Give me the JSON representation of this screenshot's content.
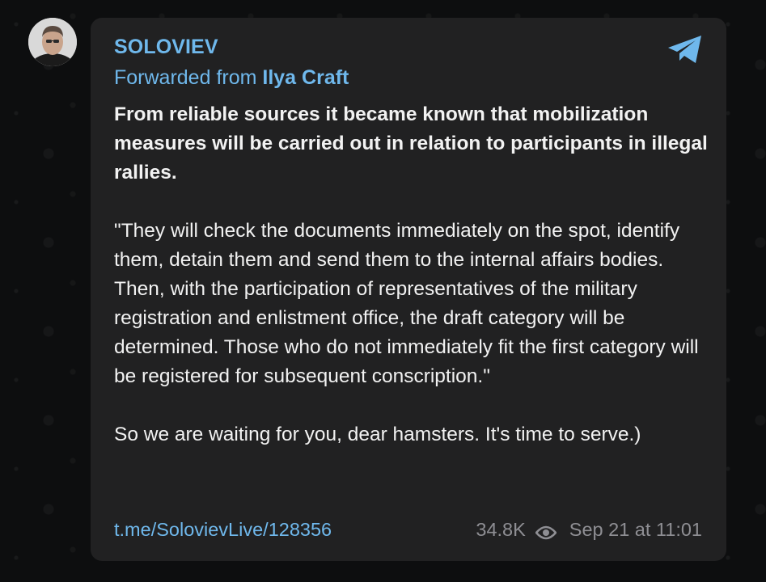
{
  "post": {
    "channel_name": "SOLOVIEV",
    "forwarded_prefix": "Forwarded from ",
    "forwarded_from": "Ilya Craft",
    "paragraphs": [
      "From reliable sources it became known that mobilization measures will be carried out in relation to participants in illegal rallies.",
      "\"They will check the documents immediately on the spot, identify them, detain them and send them to the internal affairs bodies. Then, with the participation of representatives of the military registration and enlistment office, the draft category will be determined. Those who do not immediately fit the first category will be registered for subsequent conscription.\"",
      "So we are waiting for you, dear hamsters. It's time to serve.)"
    ],
    "link": "t.me/SolovievLive/128356",
    "views": "34.8K",
    "timestamp": "Sep 21 at 11:01"
  },
  "icons": {
    "share": "telegram-share-icon",
    "views": "eye-icon",
    "avatar": "channel-avatar"
  },
  "colors": {
    "accent": "#6fb8ec",
    "bubble": "#212122",
    "text": "#f2f2f2",
    "meta": "#8e8e93"
  }
}
